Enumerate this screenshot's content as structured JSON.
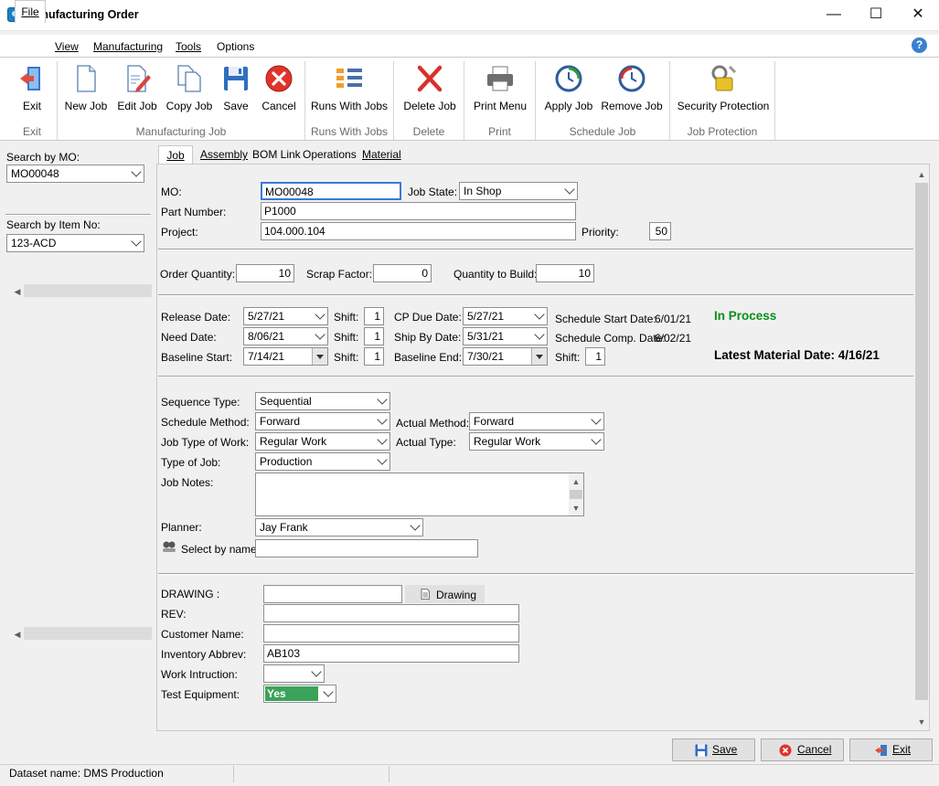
{
  "window": {
    "title": "Manufacturing Order",
    "controls": {
      "minimize": "—",
      "maximize": "☐",
      "close": "✕"
    }
  },
  "menu": [
    {
      "label": "File"
    },
    {
      "label": "View"
    },
    {
      "label": "Manufacturing"
    },
    {
      "label": "Tools"
    },
    {
      "label": "Options"
    }
  ],
  "help_glyph": "?",
  "ribbon": {
    "buttons": {
      "exit": "Exit",
      "new_job": "New Job",
      "edit_job": "Edit Job",
      "copy_job": "Copy Job",
      "save": "Save",
      "cancel": "Cancel",
      "runs_with_jobs": "Runs With Jobs",
      "delete_job": "Delete Job",
      "print_menu": "Print Menu",
      "apply_job": "Apply Job",
      "remove_job": "Remove Job",
      "security_protection": "Security Protection"
    },
    "groups": {
      "exit": "Exit",
      "manufacturing_job": "Manufacturing Job",
      "runs_with_jobs": "Runs With Jobs",
      "delete": "Delete",
      "print": "Print",
      "schedule_job": "Schedule Job",
      "job_protection": "Job Protection"
    }
  },
  "left_panel": {
    "search_mo_label": "Search by MO:",
    "search_mo_value": "MO00048",
    "search_item_label": "Search by Item No:",
    "search_item_value": "123-ACD"
  },
  "tabs": [
    "Job",
    "Assembly",
    "BOM Link",
    "Operations",
    "Material"
  ],
  "form": {
    "mo_label": "MO:",
    "mo_value": "MO00048",
    "job_state_label": "Job State:",
    "job_state_value": "In Shop",
    "part_number_label": "Part Number:",
    "part_number_value": "P1000",
    "project_label": "Project:",
    "project_value": "104.000.104",
    "priority_label": "Priority:",
    "priority_value": "50",
    "order_qty_label": "Order Quantity:",
    "order_qty_value": "10",
    "scrap_label": "Scrap Factor:",
    "scrap_value": "0",
    "qty_build_label": "Quantity to Build:",
    "qty_build_value": "10",
    "release_date_label": "Release Date:",
    "release_date_value": "5/27/21",
    "need_date_label": "Need Date:",
    "need_date_value": "8/06/21",
    "baseline_start_label": "Baseline Start:",
    "baseline_start_value": "7/14/21",
    "shift_label": "Shift:",
    "shift1": "1",
    "shift2": "1",
    "shift3": "1",
    "shift4": "1",
    "cp_due_label": "CP Due Date:",
    "cp_due_value": "5/27/21",
    "ship_by_label": "Ship By Date:",
    "ship_by_value": "5/31/21",
    "baseline_end_label": "Baseline End:",
    "baseline_end_value": "7/30/21",
    "sched_start_label": "Schedule Start Date:",
    "sched_start_value": "6/01/21",
    "sched_comp_label": "Schedule Comp. Date:",
    "sched_comp_value": "6/02/21",
    "status_text": "In Process",
    "latest_material": "Latest Material Date: 4/16/21",
    "sequence_type_label": "Sequence Type:",
    "sequence_type_value": "Sequential",
    "schedule_method_label": "Schedule Method:",
    "schedule_method_value": "Forward",
    "actual_method_label": "Actual Method:",
    "actual_method_value": "Forward",
    "job_type_label": "Job Type of Work:",
    "job_type_value": "Regular Work",
    "actual_type_label": "Actual Type:",
    "actual_type_value": "Regular Work",
    "type_of_job_label": "Type of Job:",
    "type_of_job_value": "Production",
    "job_notes_label": "Job Notes:",
    "planner_label": "Planner:",
    "planner_value": "Jay Frank",
    "select_by_name_label": "Select by name",
    "drawing_label": "DRAWING :",
    "drawing_button": "Drawing",
    "rev_label": "REV:",
    "customer_name_label": "Customer Name:",
    "inventory_abbrev_label": "Inventory Abbrev:",
    "inventory_abbrev_value": "AB103",
    "work_instruction_label": "Work Intruction:",
    "test_equipment_label": "Test Equipment:",
    "test_equipment_value": "Yes"
  },
  "footer": {
    "save": "Save",
    "cancel": "Cancel",
    "exit": "Exit"
  },
  "status_bar": {
    "dataset": "Dataset name: DMS Production"
  }
}
